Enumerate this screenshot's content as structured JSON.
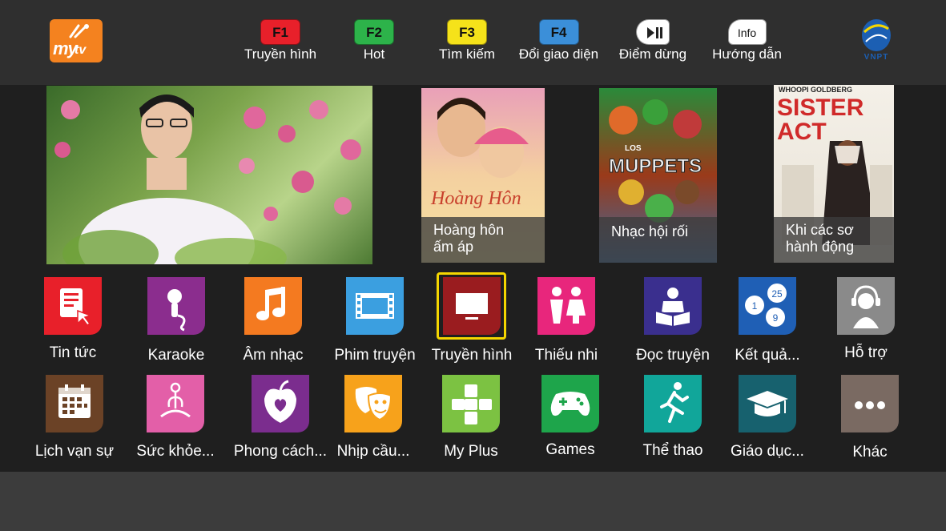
{
  "header": {
    "logo": {
      "text_my": "my",
      "text_tv": "tv",
      "color": "#f4821f"
    },
    "function_keys": [
      {
        "key": "F1",
        "label": "Truyền hình",
        "color": "#e8202a"
      },
      {
        "key": "F2",
        "label": "Hot",
        "color": "#2db34a"
      },
      {
        "key": "F3",
        "label": "Tìm kiếm",
        "color": "#f5e21a"
      },
      {
        "key": "F4",
        "label": "Đổi giao diện",
        "color": "#3b8fd9"
      },
      {
        "key": "",
        "label": "Điểm dừng",
        "icon": "play-pause-icon",
        "color": "#ffffff"
      },
      {
        "key": "Info",
        "label": "Hướng dẫn",
        "icon": "info-icon",
        "color": "#ffffff"
      }
    ],
    "brand": {
      "text": "VNPT",
      "color": "#1c5fb3"
    }
  },
  "featured": [
    {
      "caption": "Hoàng hôn\nấm áp",
      "poster_title": "Hoàng Hôn"
    },
    {
      "caption": "Nhạc hội rối",
      "poster_title": "MUPPETS",
      "poster_top": "LOS"
    },
    {
      "caption": "Khi các sơ\nhành động",
      "poster_title": "SISTER\nACT",
      "poster_top": "WHOOPI GOLDBERG"
    }
  ],
  "apps_row1": [
    {
      "label": "Tin tức",
      "icon": "news-icon",
      "color": "#e8202a"
    },
    {
      "label": "Karaoke",
      "icon": "microphone-icon",
      "color": "#8b2d8e"
    },
    {
      "label": "Âm nhạc",
      "icon": "music-note-icon",
      "color": "#f47a20"
    },
    {
      "label": "Phim truyện",
      "icon": "film-icon",
      "color": "#3b9fe0"
    },
    {
      "label": "Truyền hình",
      "icon": "tv-icon",
      "color": "#9a1c1f"
    },
    {
      "label": "Thiếu nhi",
      "icon": "children-icon",
      "color": "#e8267c"
    },
    {
      "label": "Đọc truyện",
      "icon": "reading-icon",
      "color": "#3a2f8e"
    },
    {
      "label": "Kết quả...",
      "icon": "lottery-balls-icon",
      "color": "#1f5fb5",
      "balls": [
        "25",
        "1",
        "9"
      ]
    },
    {
      "label": "Hỗ trợ",
      "icon": "support-headset-icon",
      "color": "#8a8a8a"
    }
  ],
  "apps_row2": [
    {
      "label": "Lịch vạn sự",
      "icon": "calendar-icon",
      "color": "#6b4226"
    },
    {
      "label": "Sức khỏe...",
      "icon": "yoga-icon",
      "color": "#e35fa8"
    },
    {
      "label": "Phong cách...",
      "icon": "heart-apple-icon",
      "color": "#7b2d8e"
    },
    {
      "label": "Nhịp cầu...",
      "icon": "theater-masks-icon",
      "color": "#f7a21b"
    },
    {
      "label": "My Plus",
      "icon": "plus-icon",
      "color": "#7cc242"
    },
    {
      "label": "Games",
      "icon": "gamepad-icon",
      "color": "#1ea54b"
    },
    {
      "label": "Thể thao",
      "icon": "runner-icon",
      "color": "#11a69a"
    },
    {
      "label": "Giáo dục...",
      "icon": "graduation-cap-icon",
      "color": "#17616e"
    },
    {
      "label": "Khác",
      "icon": "more-dots-icon",
      "color": "#7a6a62"
    }
  ]
}
